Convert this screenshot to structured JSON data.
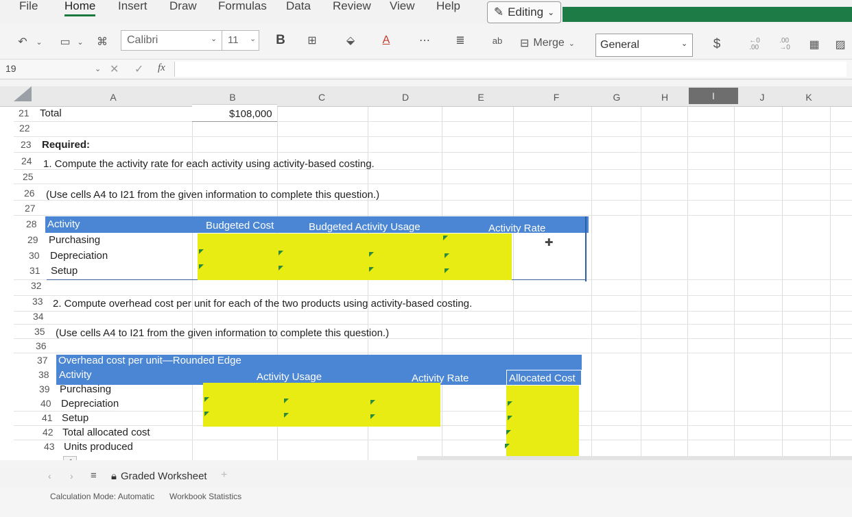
{
  "ribbon": {
    "tabs": [
      "File",
      "Home",
      "Insert",
      "Draw",
      "Formulas",
      "Data",
      "Review",
      "View",
      "Help"
    ],
    "editing_label": "Editing",
    "font_name": "Calibri",
    "font_size": "11",
    "bold_label": "B",
    "merge_label": "Merge",
    "number_format": "General",
    "currency_symbol": "$",
    "inc_decimal": "←0\n.00",
    "dec_decimal": ".00\n→0",
    "ab_label": "ab"
  },
  "formula_bar": {
    "name_box": "19",
    "fx": "fx"
  },
  "columns": [
    "A",
    "B",
    "C",
    "D",
    "E",
    "F",
    "G",
    "H",
    "I",
    "J",
    "K"
  ],
  "rows": [
    "21",
    "22",
    "23",
    "24",
    "25",
    "26",
    "27",
    "28",
    "29",
    "30",
    "31",
    "32",
    "33",
    "34",
    "35",
    "36",
    "37",
    "38",
    "39",
    "40",
    "41",
    "42",
    "43"
  ],
  "cells": {
    "a21": "Total",
    "b21": "$108,000",
    "a23": "Required:",
    "a24": "1. Compute the activity rate for each activity using activity-based costing.",
    "a26": "(Use cells A4 to I21 from the given information to complete this question.)",
    "a33": "2. Compute overhead cost per unit for each of the two products using activity-based costing.",
    "a35": "(Use cells A4 to I21 from the given information to complete this question.)"
  },
  "table1": {
    "headers": [
      "Activity",
      "Budgeted Cost",
      "Budgeted Activity Usage",
      "Activity Rate"
    ],
    "rows": [
      "Purchasing",
      "Depreciation",
      "Setup"
    ]
  },
  "table2": {
    "title": "Overhead cost per unit—Rounded Edge",
    "headers": [
      "Activity",
      "Activity Usage",
      "Activity Rate",
      "Allocated Cost"
    ],
    "rows": [
      "Purchasing",
      "Depreciation",
      "Setup",
      "Total allocated cost",
      "Units produced"
    ]
  },
  "sheet_tab": "Graded Worksheet",
  "status": {
    "calc_mode": "Calculation Mode: Automatic",
    "stats": "Workbook Statistics"
  },
  "colors": {
    "header_blue": "#4a86d4",
    "input_yellow": "#e8ec12",
    "accent_green": "#1d7b45"
  }
}
